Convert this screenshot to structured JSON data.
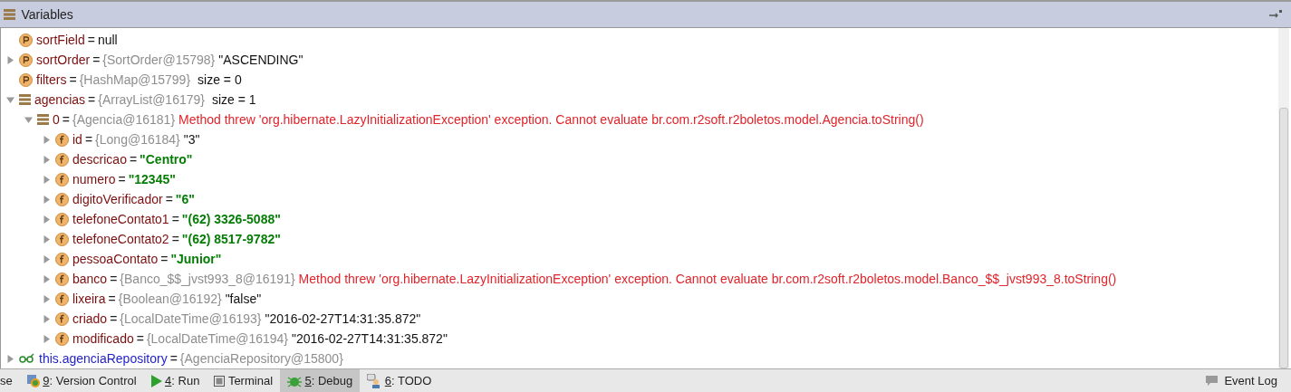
{
  "panel": {
    "title": "Variables"
  },
  "variables": [
    {
      "kind": "property",
      "name": "sortField",
      "equals": "=",
      "value": "null",
      "error": false,
      "string_literal": false,
      "expandable": false
    },
    {
      "kind": "property",
      "name": "sortOrder",
      "equals": "=",
      "type": "{SortOrder@15798}",
      "value": "\"ASCENDING\"",
      "error": false,
      "string_literal": false,
      "expandable": true,
      "expanded": false
    },
    {
      "kind": "property",
      "name": "filters",
      "equals": "=",
      "type": "{HashMap@15799}",
      "size": "size = 0",
      "expandable": false
    },
    {
      "kind": "list",
      "name": "agencias",
      "equals": "=",
      "type": "{ArrayList@16179}",
      "size": "size = 1",
      "expandable": true,
      "expanded": true,
      "children": [
        {
          "kind": "list",
          "name": "0",
          "equals": "=",
          "type": "{Agencia@16181}",
          "value": "Method threw 'org.hibernate.LazyInitializationException' exception. Cannot evaluate br.com.r2soft.r2boletos.model.Agencia.toString()",
          "error": true,
          "string_literal": false,
          "expandable": true,
          "expanded": true,
          "children": [
            {
              "kind": "field",
              "name": "id",
              "equals": "=",
              "type": "{Long@16184}",
              "value": "\"3\"",
              "error": false,
              "string_literal": false,
              "expandable": true,
              "expanded": false
            },
            {
              "kind": "field",
              "name": "descricao",
              "equals": "=",
              "value": "\"Centro\"",
              "error": false,
              "string_literal": true,
              "expandable": true,
              "expanded": false
            },
            {
              "kind": "field",
              "name": "numero",
              "equals": "=",
              "value": "\"12345\"",
              "error": false,
              "string_literal": true,
              "expandable": true,
              "expanded": false
            },
            {
              "kind": "field",
              "name": "digitoVerificador",
              "equals": "=",
              "value": "\"6\"",
              "error": false,
              "string_literal": true,
              "expandable": true,
              "expanded": false
            },
            {
              "kind": "field",
              "name": "telefoneContato1",
              "equals": "=",
              "value": "\"(62) 3326-5088\"",
              "error": false,
              "string_literal": true,
              "expandable": true,
              "expanded": false
            },
            {
              "kind": "field",
              "name": "telefoneContato2",
              "equals": "=",
              "value": "\"(62) 8517-9782\"",
              "error": false,
              "string_literal": true,
              "expandable": true,
              "expanded": false
            },
            {
              "kind": "field",
              "name": "pessoaContato",
              "equals": "=",
              "value": "\"Junior\"",
              "error": false,
              "string_literal": true,
              "expandable": true,
              "expanded": false
            },
            {
              "kind": "field",
              "name": "banco",
              "equals": "=",
              "type": "{Banco_$$_jvst993_8@16191}",
              "value": "Method threw 'org.hibernate.LazyInitializationException' exception. Cannot evaluate br.com.r2soft.r2boletos.model.Banco_$$_jvst993_8.toString()",
              "error": true,
              "string_literal": false,
              "expandable": true,
              "expanded": false
            },
            {
              "kind": "field",
              "name": "lixeira",
              "equals": "=",
              "type": "{Boolean@16192}",
              "value": "\"false\"",
              "error": false,
              "string_literal": false,
              "expandable": true,
              "expanded": false
            },
            {
              "kind": "field",
              "name": "criado",
              "equals": "=",
              "type": "{LocalDateTime@16193}",
              "value": "\"2016-02-27T14:31:35.872\"",
              "error": false,
              "string_literal": false,
              "expandable": true,
              "expanded": false
            },
            {
              "kind": "field",
              "name": "modificado",
              "equals": "=",
              "type": "{LocalDateTime@16194}",
              "value": "\"2016-02-27T14:31:35.872\"",
              "error": false,
              "string_literal": false,
              "expandable": true,
              "expanded": false
            }
          ]
        }
      ]
    },
    {
      "kind": "watch",
      "name": "this.agenciaRepository",
      "equals": "=",
      "type": "{AgenciaRepository@15800}",
      "expandable": true,
      "expanded": false
    }
  ],
  "tool_tabs": [
    {
      "kind": "cut",
      "label": "se",
      "selected": false
    },
    {
      "kind": "vcs",
      "mnemonic": "9",
      "label": ": Version Control",
      "selected": false
    },
    {
      "kind": "run",
      "mnemonic": "4",
      "label": ": Run",
      "selected": false
    },
    {
      "kind": "terminal",
      "label": "Terminal",
      "selected": false
    },
    {
      "kind": "debug",
      "mnemonic": "5",
      "label": ": Debug",
      "selected": true
    },
    {
      "kind": "todo",
      "mnemonic": "6",
      "label": ": TODO",
      "selected": false
    }
  ],
  "event_log": {
    "label": "Event Log"
  }
}
